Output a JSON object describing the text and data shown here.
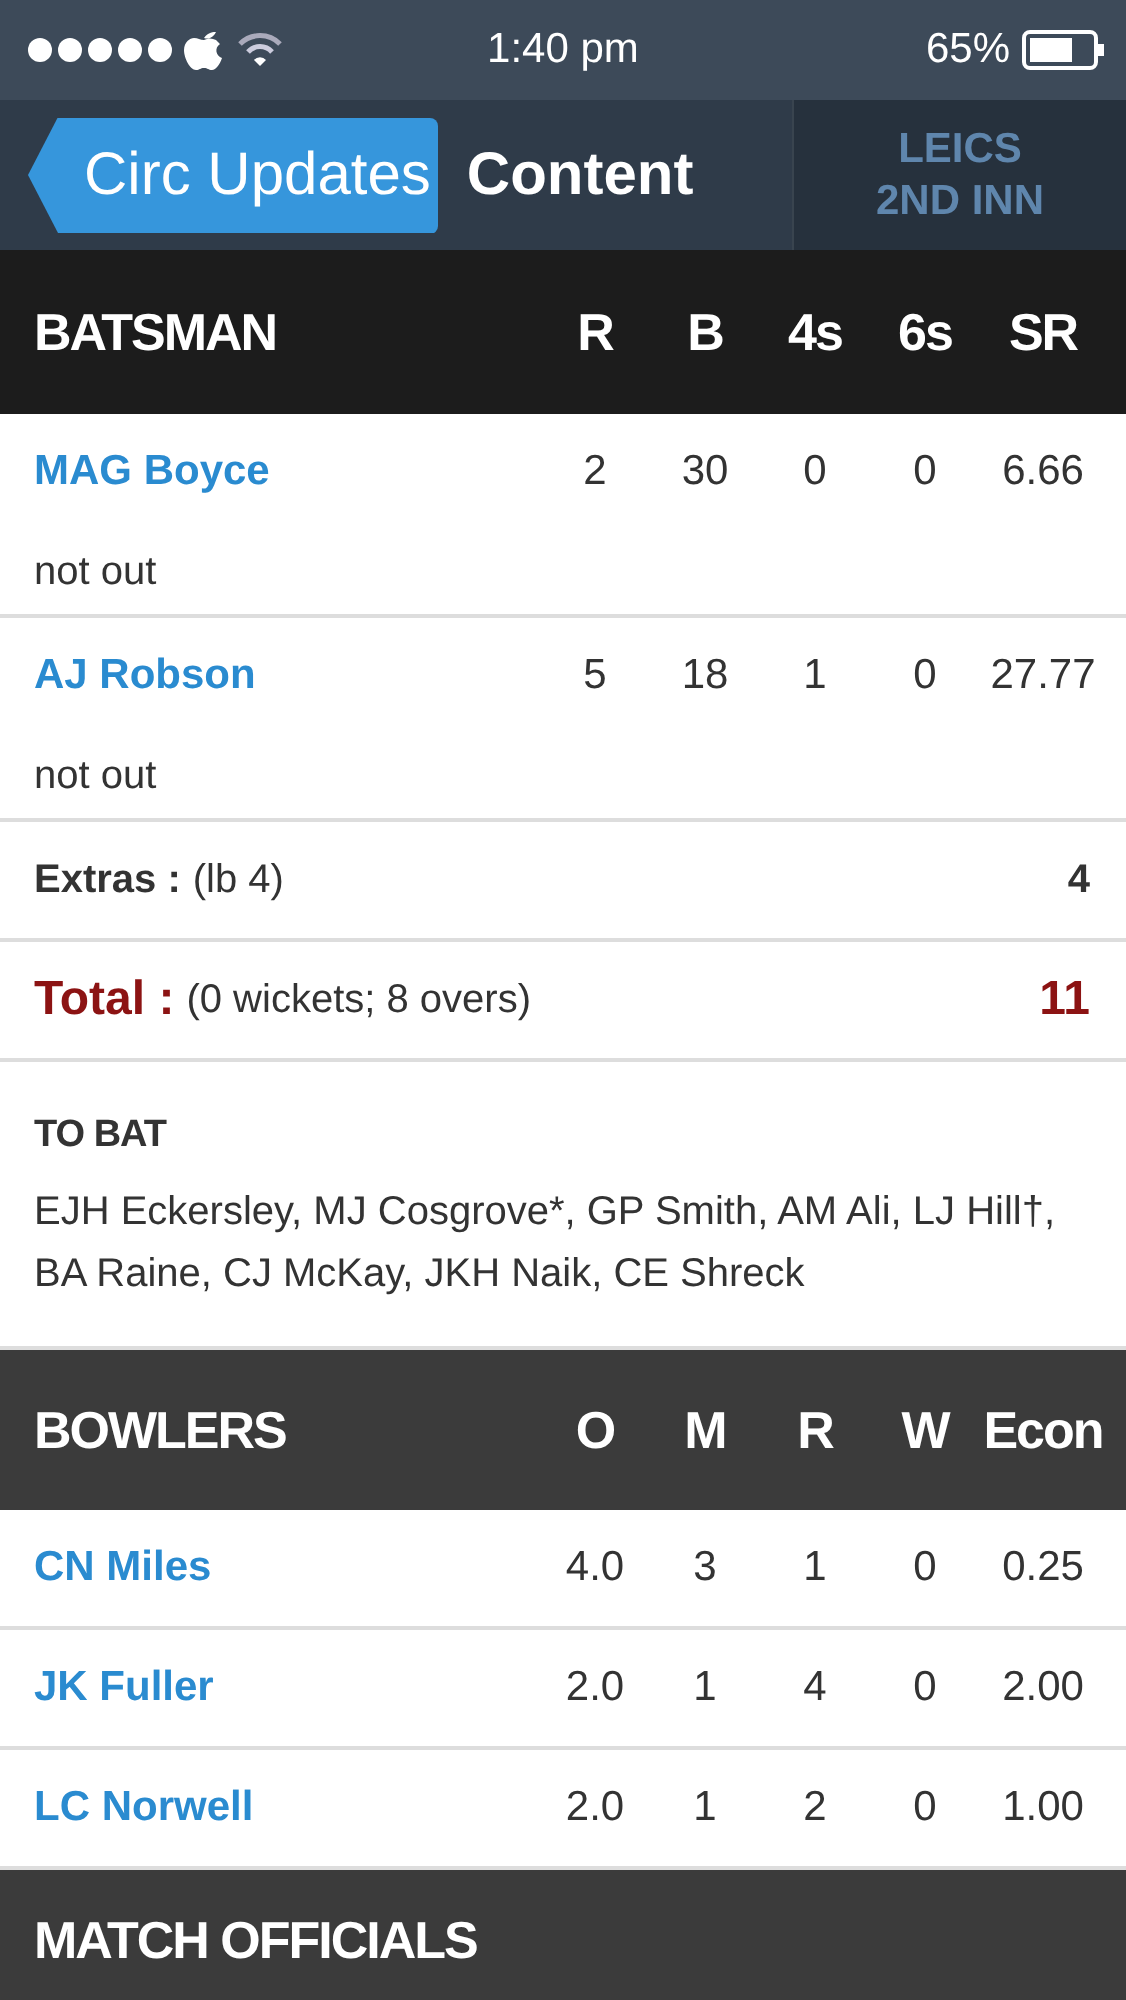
{
  "status_bar": {
    "time": "1:40 pm",
    "battery": "65%"
  },
  "nav": {
    "back": "Circ Updates",
    "title": "Content",
    "tabs": [
      {
        "team": "LEICS",
        "innings": "2ND INN",
        "selected": true
      }
    ]
  },
  "batting": {
    "columns": [
      "BATSMAN",
      "R",
      "B",
      "4s",
      "6s",
      "SR"
    ],
    "rows": [
      {
        "name": "MAG Boyce",
        "stats": [
          "2",
          "30",
          "0",
          "0",
          "6.66"
        ],
        "dismissal": "not out"
      },
      {
        "name": "AJ Robson",
        "stats": [
          "5",
          "18",
          "1",
          "0",
          "27.77"
        ],
        "dismissal": "not out"
      }
    ],
    "extras": {
      "label": "Extras :",
      "detail": "(lb 4)",
      "value": "4"
    },
    "total": {
      "label": "Total :",
      "detail": "(0 wickets; 8 overs)",
      "value": "11"
    },
    "to_bat": {
      "heading": "TO BAT",
      "players": "EJH Eckersley, MJ Cosgrove*, GP Smith, AM Ali, LJ Hill†, BA Raine, CJ McKay, JKH Naik, CE Shreck"
    }
  },
  "bowling": {
    "columns": [
      "BOWLERS",
      "O",
      "M",
      "R",
      "W",
      "Econ"
    ],
    "rows": [
      {
        "name": "CN Miles",
        "stats": [
          "4.0",
          "3",
          "1",
          "0",
          "0.25"
        ]
      },
      {
        "name": "JK Fuller",
        "stats": [
          "2.0",
          "1",
          "4",
          "0",
          "2.00"
        ]
      },
      {
        "name": "LC Norwell",
        "stats": [
          "2.0",
          "1",
          "2",
          "0",
          "1.00"
        ]
      }
    ]
  },
  "officials": {
    "heading": "MATCH OFFICIALS"
  }
}
